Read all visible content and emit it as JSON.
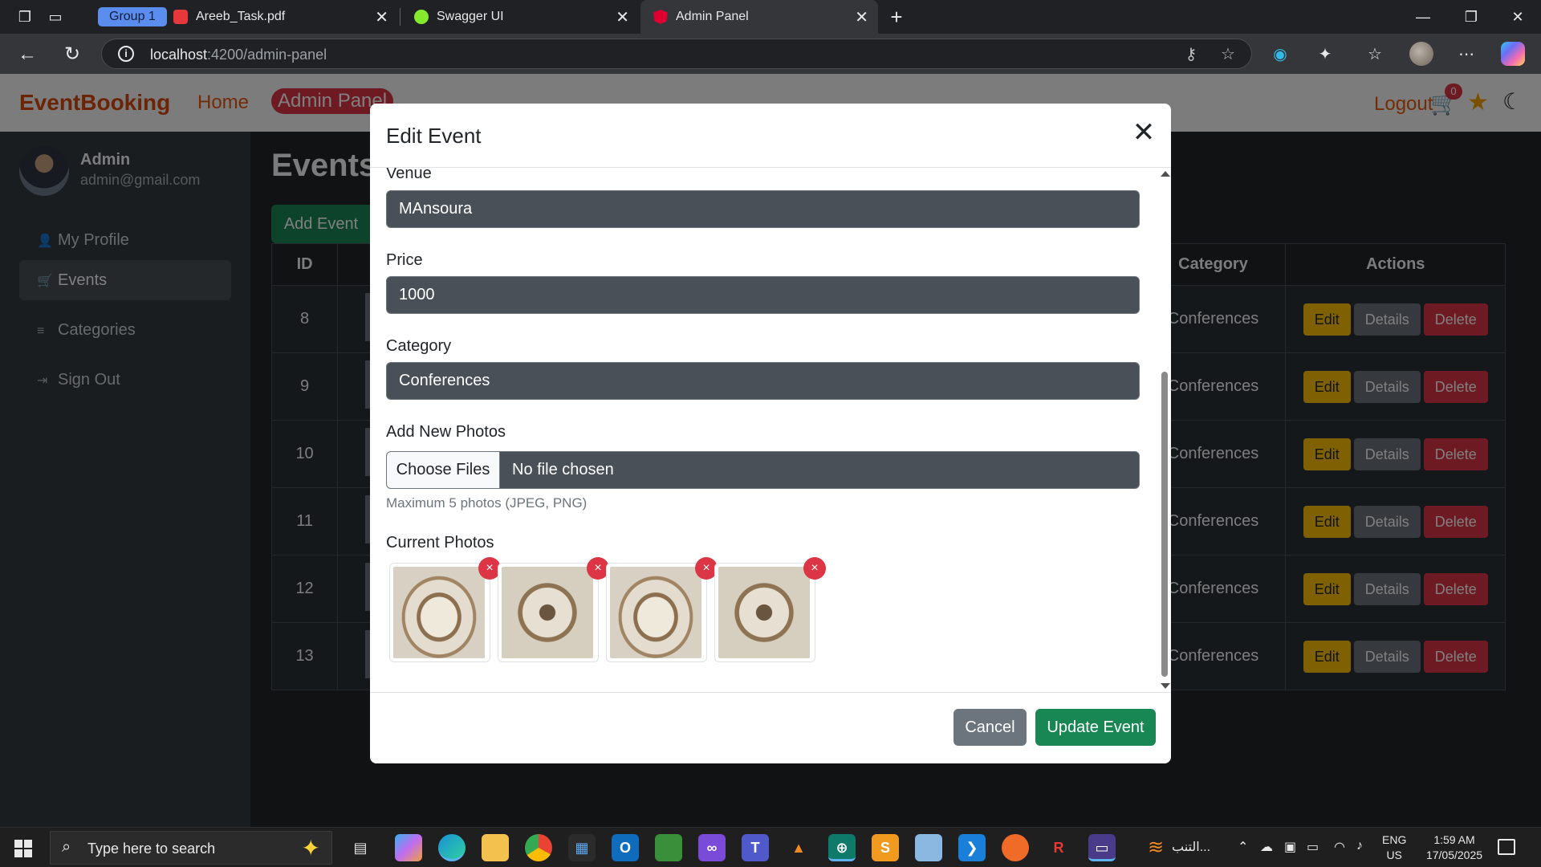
{
  "browser": {
    "tab_group_label": "Group 1",
    "tabs": [
      {
        "title": "Areeb_Task.pdf",
        "icon": "pdf-icon",
        "color": "#e5383b"
      },
      {
        "title": "Swagger UI",
        "icon": "swagger-icon",
        "color": "#85ea2d"
      },
      {
        "title": "Admin Panel",
        "icon": "angular-icon",
        "color": "#dd0031",
        "active": true
      }
    ],
    "address_host": "localhost",
    "address_path": ":4200/admin-panel"
  },
  "app": {
    "brand": "EventBooking",
    "nav": {
      "home": "Home",
      "admin_panel": "Admin Panel",
      "logout": "Logout",
      "cart_count": "0"
    },
    "profile": {
      "name": "Admin",
      "email": "admin@gmail.com"
    },
    "sidebar": [
      {
        "label": "My Profile",
        "icon": "user-icon"
      },
      {
        "label": "Events",
        "icon": "cart-icon",
        "active": true
      },
      {
        "label": "Categories",
        "icon": "list-icon"
      },
      {
        "label": "Sign Out",
        "icon": "sign-out-icon"
      }
    ],
    "page_title": "Events",
    "add_event_label": "Add Event",
    "table": {
      "headers": {
        "id": "ID",
        "category": "Category",
        "actions": "Actions"
      },
      "rows": [
        {
          "id": "8",
          "category": "Conferences"
        },
        {
          "id": "9",
          "category": "Conferences"
        },
        {
          "id": "10",
          "category": "Conferences"
        },
        {
          "id": "11",
          "category": "Conferences"
        },
        {
          "id": "12",
          "category": "Conferences"
        },
        {
          "id": "13",
          "category": "Conferences"
        }
      ],
      "action_labels": {
        "edit": "Edit",
        "details": "Details",
        "delete": "Delete"
      }
    }
  },
  "modal": {
    "title": "Edit Event",
    "close_glyph": "✕",
    "fields": {
      "venue": {
        "label": "Venue",
        "value": "MAnsoura"
      },
      "price": {
        "label": "Price",
        "value": "1000"
      },
      "category": {
        "label": "Category",
        "value": "Conferences"
      }
    },
    "photos_upload": {
      "label": "Add New Photos",
      "button": "Choose Files",
      "status": "No file chosen",
      "help": "Maximum 5 photos (JPEG, PNG)"
    },
    "current_photos_label": "Current Photos",
    "current_photos_count": 4,
    "remove_glyph": "×",
    "cancel_label": "Cancel",
    "update_label": "Update Event"
  },
  "taskbar": {
    "search_placeholder": "Type here to search",
    "tray_weather_text": "التنب...",
    "lang_top": "ENG",
    "lang_bottom": "US",
    "time": "1:59 AM",
    "date": "17/05/2025"
  },
  "colors": {
    "brand": "#d9480f",
    "success": "#198754",
    "danger": "#dc3545",
    "warning": "#ffc107",
    "secondary": "#6c757d"
  }
}
